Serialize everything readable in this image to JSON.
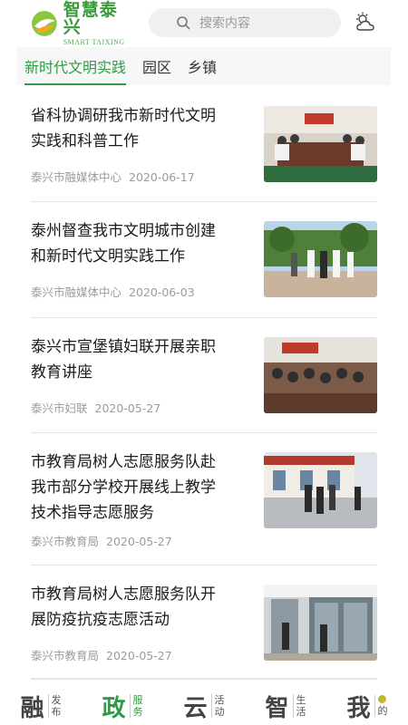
{
  "header": {
    "logo_cn": "智慧泰兴",
    "logo_en": "SMART TAIXING",
    "search_placeholder": "搜索内容"
  },
  "tabs": [
    {
      "label": "新时代文明实践",
      "active": true
    },
    {
      "label": "园区",
      "active": false
    },
    {
      "label": "乡镇",
      "active": false
    }
  ],
  "news": [
    {
      "title_line1": "省科协调研我市新时代文明",
      "title_line2": "实践和科普工作",
      "source": "泰兴市融媒体中心",
      "date": "2020-06-17"
    },
    {
      "title_line1": "泰州督查我市文明城市创建",
      "title_line2": "和新时代文明实践工作",
      "source": "泰兴市融媒体中心",
      "date": "2020-06-03"
    },
    {
      "title_line1": "泰兴市宣堡镇妇联开展亲职",
      "title_line2": "教育讲座",
      "source": "泰兴市妇联",
      "date": "2020-05-27"
    },
    {
      "title_line1": "市教育局树人志愿服务队赴",
      "title_line2": "我市部分学校开展线上教学",
      "title_line3": "技术指导志愿服务",
      "source": "泰兴市教育局",
      "date": "2020-05-27"
    },
    {
      "title_line1": "市教育局树人志愿服务队开",
      "title_line2": "展防疫抗疫志愿活动",
      "source": "泰兴市教育局",
      "date": "2020-05-27"
    }
  ],
  "bottom_nav": [
    {
      "big": "融",
      "small1": "发",
      "small2": "布",
      "active": false
    },
    {
      "big": "政",
      "small1": "服",
      "small2": "务",
      "active": true
    },
    {
      "big": "云",
      "small1": "活",
      "small2": "动",
      "active": false
    },
    {
      "big": "智",
      "small1": "生",
      "small2": "活",
      "active": false
    },
    {
      "big": "我",
      "small1": "",
      "small2": "的",
      "active": false
    }
  ],
  "colors": {
    "accent": "#2e9b45",
    "brand": "#3a9a3a"
  }
}
